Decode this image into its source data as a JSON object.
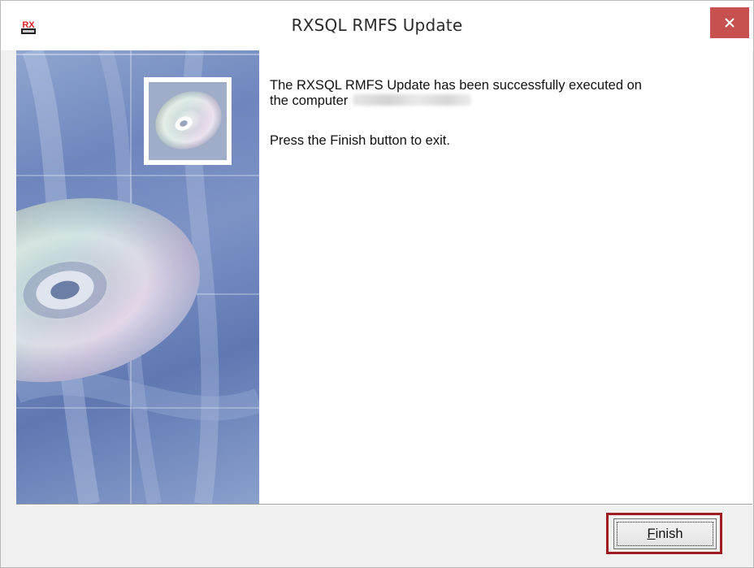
{
  "window": {
    "title": "RXSQL RMFS Update",
    "close_icon": "close-icon",
    "app_icon": "rx-logo-icon"
  },
  "content": {
    "message_line1": "The RXSQL RMFS Update has been successfully executed on",
    "message_line2": "the computer",
    "instruction": "Press the Finish button to exit."
  },
  "footer": {
    "finish_mnemonic": "F",
    "finish_rest": "inish"
  },
  "colors": {
    "close_button": "#c75050",
    "highlight_border": "#9e1b22",
    "side_panel": "#7d93c6"
  }
}
